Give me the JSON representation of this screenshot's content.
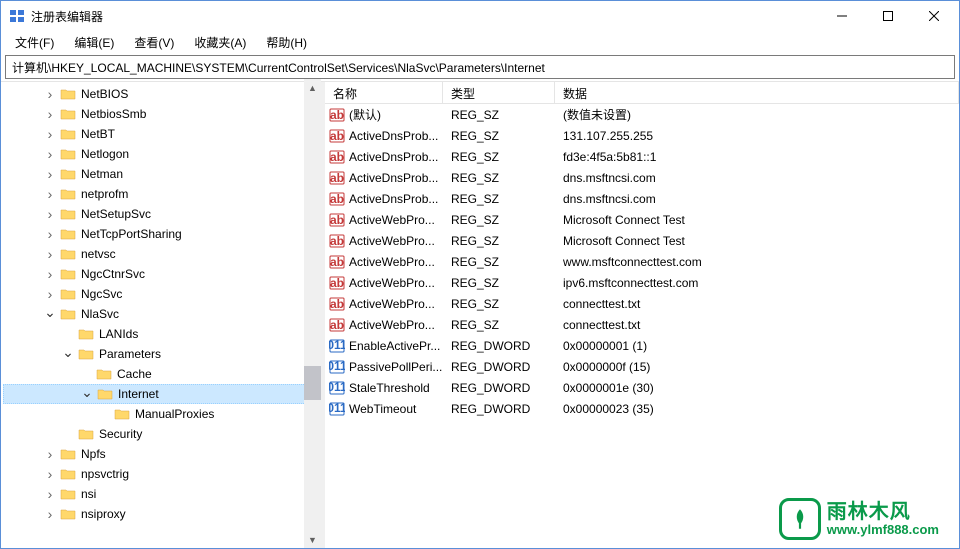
{
  "window": {
    "title": "注册表编辑器"
  },
  "menu": {
    "file": "文件(F)",
    "edit": "编辑(E)",
    "view": "查看(V)",
    "favorites": "收藏夹(A)",
    "help": "帮助(H)"
  },
  "address": "计算机\\HKEY_LOCAL_MACHINE\\SYSTEM\\CurrentControlSet\\Services\\NlaSvc\\Parameters\\Internet",
  "columns": {
    "name": "名称",
    "type": "类型",
    "data": "数据"
  },
  "tree": [
    {
      "depth": 2,
      "exp": ">",
      "label": "NetBIOS"
    },
    {
      "depth": 2,
      "exp": ">",
      "label": "NetbiosSmb"
    },
    {
      "depth": 2,
      "exp": ">",
      "label": "NetBT"
    },
    {
      "depth": 2,
      "exp": ">",
      "label": "Netlogon"
    },
    {
      "depth": 2,
      "exp": ">",
      "label": "Netman"
    },
    {
      "depth": 2,
      "exp": ">",
      "label": "netprofm"
    },
    {
      "depth": 2,
      "exp": ">",
      "label": "NetSetupSvc"
    },
    {
      "depth": 2,
      "exp": ">",
      "label": "NetTcpPortSharing"
    },
    {
      "depth": 2,
      "exp": ">",
      "label": "netvsc"
    },
    {
      "depth": 2,
      "exp": ">",
      "label": "NgcCtnrSvc"
    },
    {
      "depth": 2,
      "exp": ">",
      "label": "NgcSvc"
    },
    {
      "depth": 2,
      "exp": "v",
      "label": "NlaSvc"
    },
    {
      "depth": 3,
      "exp": "",
      "label": "LANIds"
    },
    {
      "depth": 3,
      "exp": "v",
      "label": "Parameters"
    },
    {
      "depth": 4,
      "exp": "",
      "label": "Cache"
    },
    {
      "depth": 4,
      "exp": "v",
      "label": "Internet",
      "selected": true
    },
    {
      "depth": 5,
      "exp": "",
      "label": "ManualProxies"
    },
    {
      "depth": 3,
      "exp": "",
      "label": "Security"
    },
    {
      "depth": 2,
      "exp": ">",
      "label": "Npfs"
    },
    {
      "depth": 2,
      "exp": ">",
      "label": "npsvctrig"
    },
    {
      "depth": 2,
      "exp": ">",
      "label": "nsi"
    },
    {
      "depth": 2,
      "exp": ">",
      "label": "nsiproxy"
    }
  ],
  "values": [
    {
      "icon": "sz",
      "name": "(默认)",
      "type": "REG_SZ",
      "data": "(数值未设置)"
    },
    {
      "icon": "sz",
      "name": "ActiveDnsProb...",
      "type": "REG_SZ",
      "data": "131.107.255.255"
    },
    {
      "icon": "sz",
      "name": "ActiveDnsProb...",
      "type": "REG_SZ",
      "data": "fd3e:4f5a:5b81::1"
    },
    {
      "icon": "sz",
      "name": "ActiveDnsProb...",
      "type": "REG_SZ",
      "data": "dns.msftncsi.com"
    },
    {
      "icon": "sz",
      "name": "ActiveDnsProb...",
      "type": "REG_SZ",
      "data": "dns.msftncsi.com"
    },
    {
      "icon": "sz",
      "name": "ActiveWebPro...",
      "type": "REG_SZ",
      "data": "Microsoft Connect Test"
    },
    {
      "icon": "sz",
      "name": "ActiveWebPro...",
      "type": "REG_SZ",
      "data": "Microsoft Connect Test"
    },
    {
      "icon": "sz",
      "name": "ActiveWebPro...",
      "type": "REG_SZ",
      "data": "www.msftconnecttest.com"
    },
    {
      "icon": "sz",
      "name": "ActiveWebPro...",
      "type": "REG_SZ",
      "data": "ipv6.msftconnecttest.com"
    },
    {
      "icon": "sz",
      "name": "ActiveWebPro...",
      "type": "REG_SZ",
      "data": "connecttest.txt"
    },
    {
      "icon": "sz",
      "name": "ActiveWebPro...",
      "type": "REG_SZ",
      "data": "connecttest.txt"
    },
    {
      "icon": "dw",
      "name": "EnableActivePr...",
      "type": "REG_DWORD",
      "data": "0x00000001 (1)"
    },
    {
      "icon": "dw",
      "name": "PassivePollPeri...",
      "type": "REG_DWORD",
      "data": "0x0000000f (15)"
    },
    {
      "icon": "dw",
      "name": "StaleThreshold",
      "type": "REG_DWORD",
      "data": "0x0000001e (30)"
    },
    {
      "icon": "dw",
      "name": "WebTimeout",
      "type": "REG_DWORD",
      "data": "0x00000023 (35)"
    }
  ],
  "watermark": {
    "cn": "雨林木风",
    "en": "www.ylmf888.com"
  }
}
